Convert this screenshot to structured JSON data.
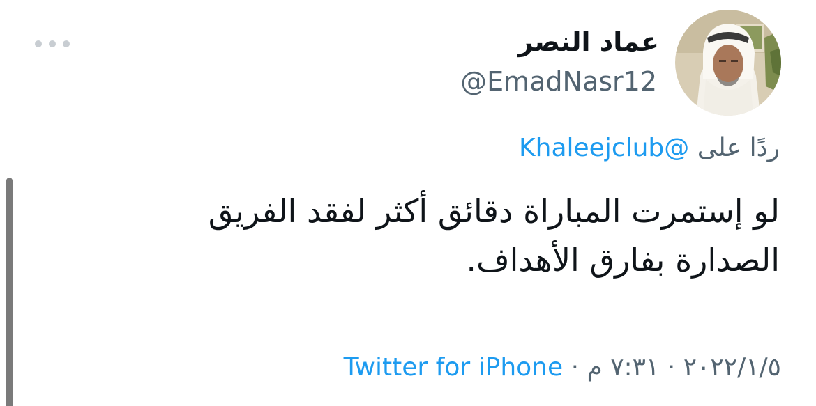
{
  "author": {
    "display_name": "عماد النصر",
    "handle": "@EmadNasr12"
  },
  "reply": {
    "prefix": "ردًا على",
    "mention": "@Khaleejclub"
  },
  "tweet": {
    "line1": "لو إستمرت المباراة دقائق أكثر لفقد الفريق",
    "line2": "الصدارة بفارق الأهداف."
  },
  "meta": {
    "date": "٢٠٢٢/١/٥",
    "separator": "·",
    "time": "٧:٣١ م",
    "source": "Twitter for iPhone"
  },
  "icons": {
    "more": "more-horizontal-icon"
  },
  "colors": {
    "accent": "#1d9bf0",
    "secondary_text": "#536471",
    "primary_text": "#0f1419",
    "more_dots": "#c8cdd2"
  }
}
